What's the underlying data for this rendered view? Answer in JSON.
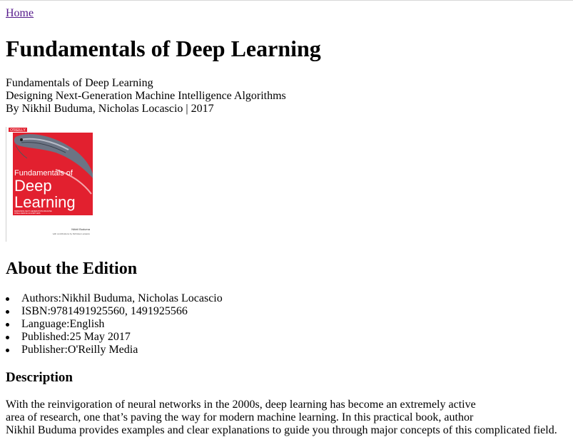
{
  "nav": {
    "home_label": "Home"
  },
  "book": {
    "title": "Fundamentals of Deep Learning",
    "subtitle_line": "Fundamentals of Deep Learning",
    "tagline": "Designing Next-Generation Machine Intelligence Algorithms",
    "byline": "By Nikhil Buduma, Nicholas Locascio | 2017"
  },
  "cover": {
    "publisher_mark": "O'REILLY",
    "title_line1": "Fundamentals of",
    "title_line2": "Deep",
    "title_line3": "Learning",
    "small_text1": "DESIGNING NEXT-GENERATION MACHINE",
    "small_text2": "INTELLIGENCE ALGORITHMS",
    "author": "Nikhil Buduma",
    "contrib": "with contributions by Nicholas Locascio",
    "colors": {
      "band": "#e2202f",
      "background": "#ffffff"
    }
  },
  "about": {
    "heading": "About the Edition",
    "items": [
      {
        "label": "Authors:",
        "value": "Nikhil Buduma, Nicholas Locascio"
      },
      {
        "label": "ISBN:",
        "value": "9781491925560, 1491925566"
      },
      {
        "label": "Language:",
        "value": "English"
      },
      {
        "label": "Published:",
        "value": "25 May 2017"
      },
      {
        "label": "Publisher:",
        "value": "O'Reilly Media"
      }
    ]
  },
  "description": {
    "heading": "Description",
    "lines": [
      "With the reinvigoration of neural networks in the 2000s, deep learning has become an extremely active",
      "area of research, one that’s paving the way for modern machine learning. In this practical book, author",
      "Nikhil Buduma provides examples and clear explanations to guide you through major concepts of this complicated field."
    ]
  }
}
